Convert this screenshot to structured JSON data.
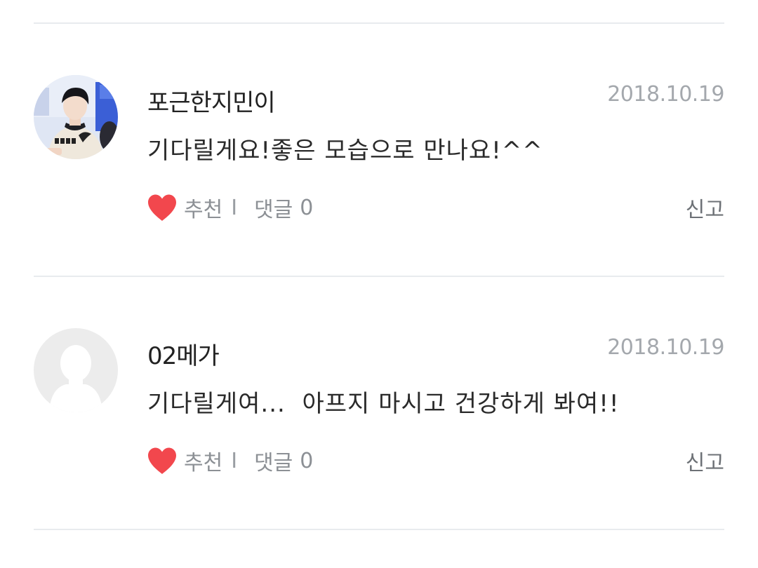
{
  "comments": [
    {
      "author": "포근한지민이",
      "date": "2018.10.19",
      "text": "기다릴게요!좋은 모습으로 만나요!^^",
      "avatar": "photo-avatar",
      "like_label": "추천",
      "separator": "I",
      "reply_label": "댓글",
      "reply_count": "0",
      "report_label": "신고"
    },
    {
      "author": "02메가",
      "date": "2018.10.19",
      "text": "기다릴게여...  아프지 마시고 건강하게 봐여!!",
      "avatar": "default-avatar",
      "like_label": "추천",
      "separator": "I",
      "reply_label": "댓글",
      "reply_count": "0",
      "report_label": "신고"
    }
  ],
  "colors": {
    "heart": "#f2474d",
    "divider": "#e8ebee",
    "date_text": "#a4a8ad",
    "action_text": "#8c9095"
  },
  "icons": {
    "like": "heart-icon",
    "default_avatar": "user-silhouette-icon"
  }
}
